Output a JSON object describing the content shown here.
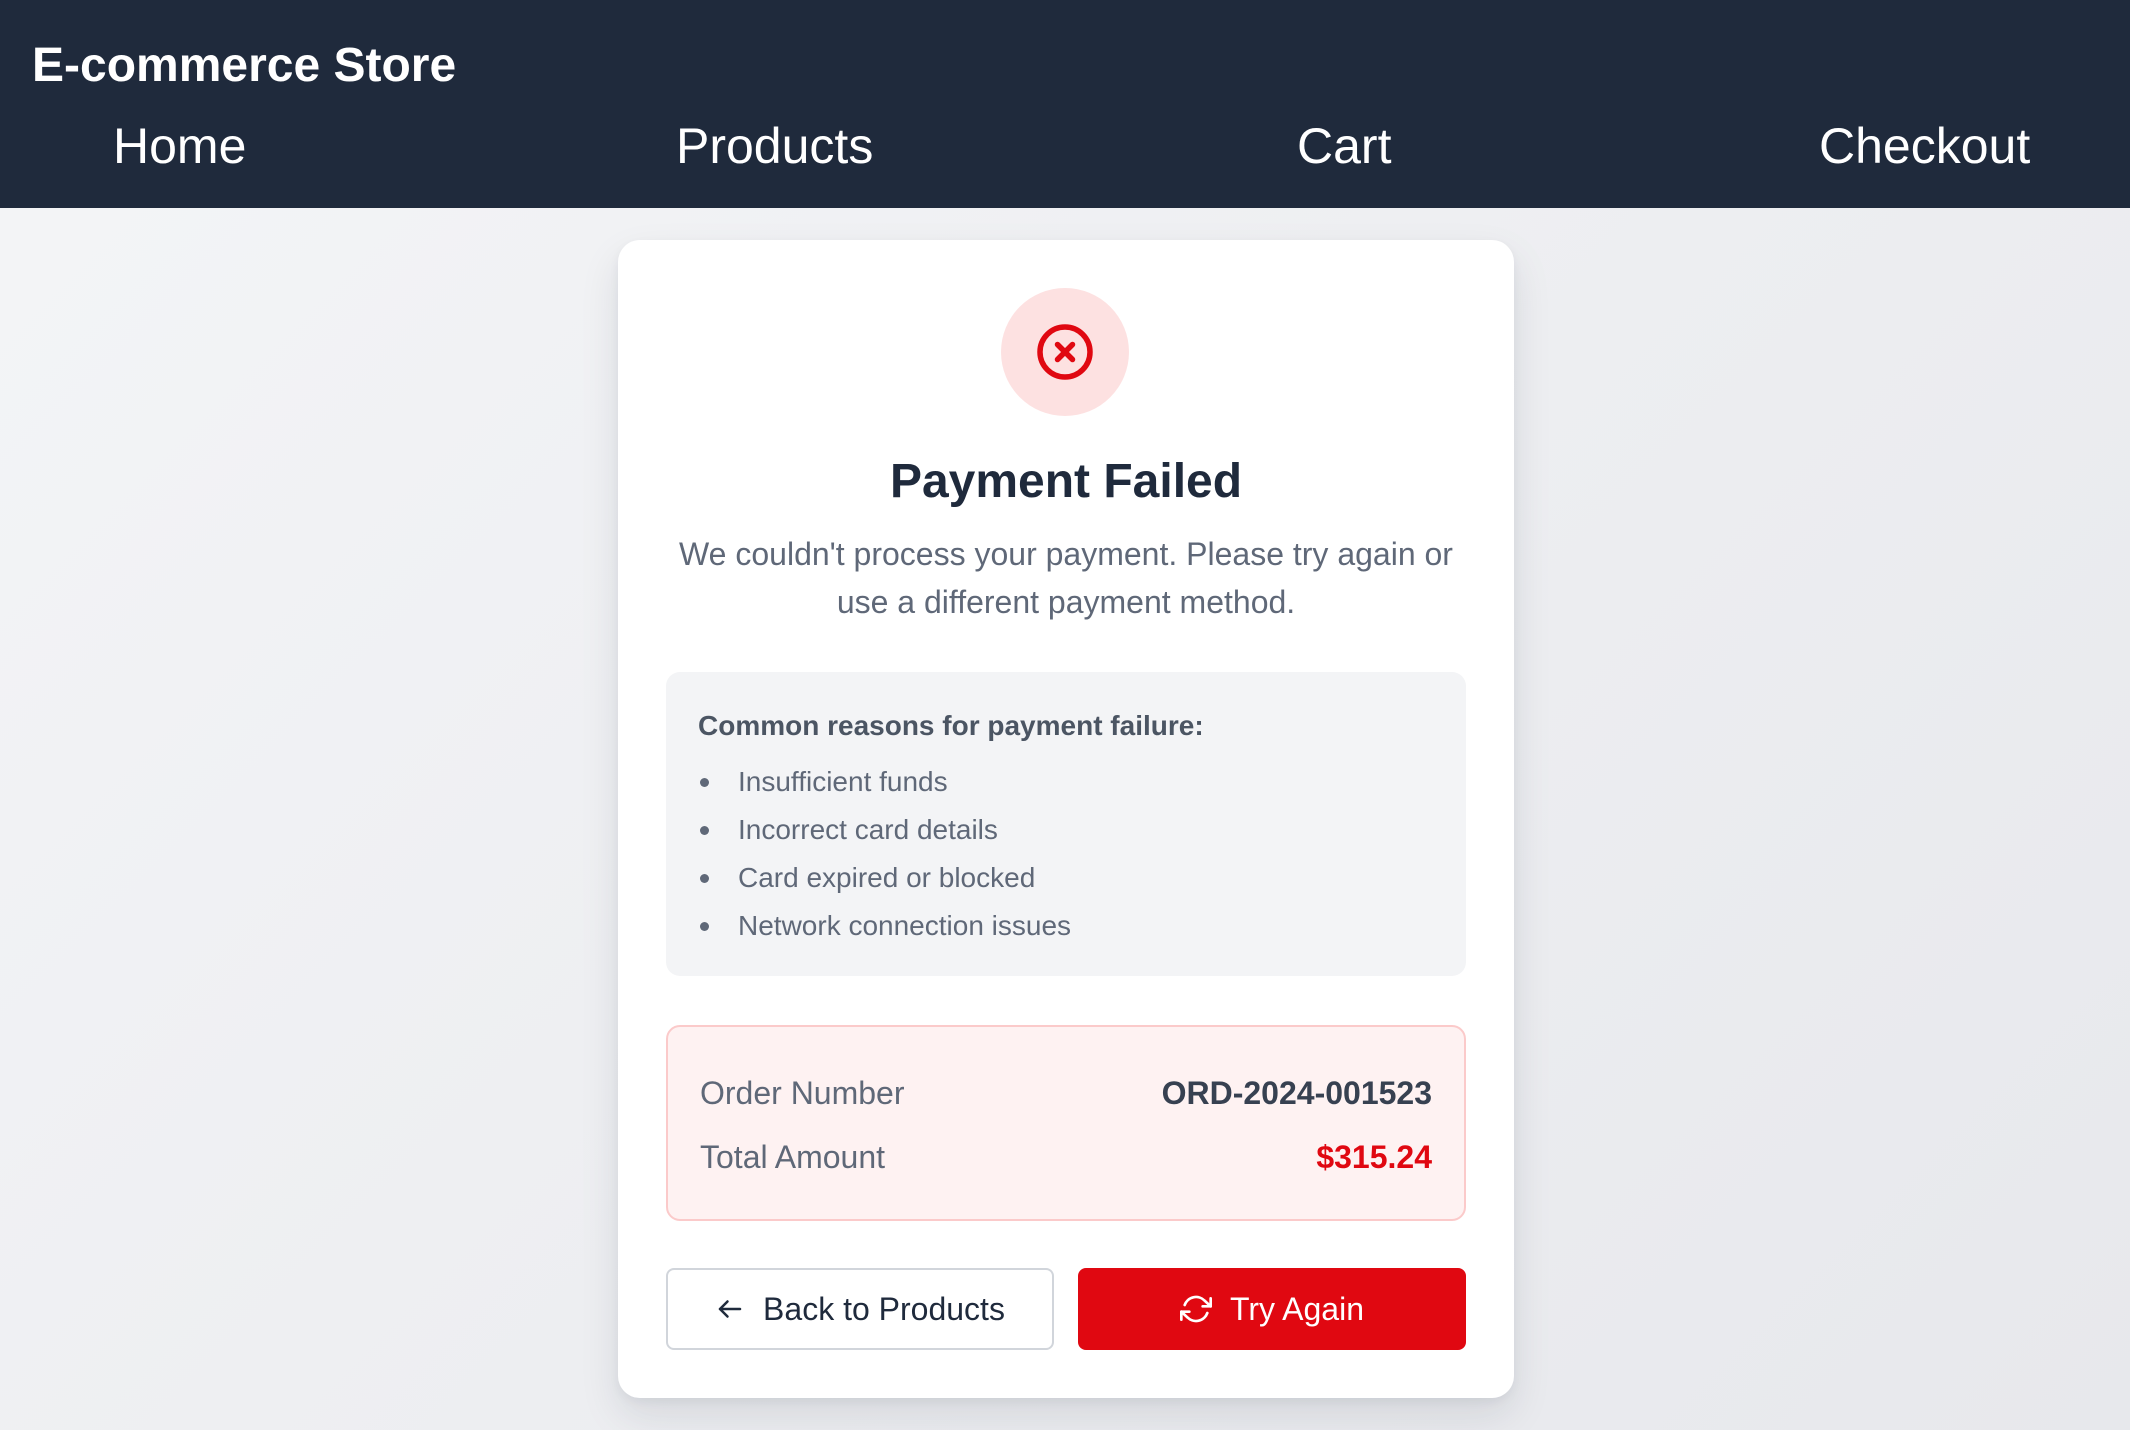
{
  "header": {
    "brand": "E-commerce Store",
    "nav": {
      "home": "Home",
      "products": "Products",
      "cart": "Cart",
      "checkout": "Checkout"
    }
  },
  "status": {
    "icon": "x-circle-icon",
    "title": "Payment Failed",
    "message": "We couldn't process your payment. Please try again or use a different payment method."
  },
  "reasons": {
    "heading": "Common reasons for payment failure:",
    "items": [
      "Insufficient funds",
      "Incorrect card details",
      "Card expired or blocked",
      "Network connection issues"
    ]
  },
  "order": {
    "number_label": "Order Number",
    "number_value": "ORD-2024-001523",
    "total_label": "Total Amount",
    "total_value": "$315.24"
  },
  "actions": {
    "back_label": "Back to Products",
    "back_icon": "arrow-left-icon",
    "retry_label": "Try Again",
    "retry_icon": "refresh-icon"
  },
  "colors": {
    "header_bg": "#1f2a3c",
    "error": "#e00811",
    "error_soft": "#fde1e1"
  }
}
